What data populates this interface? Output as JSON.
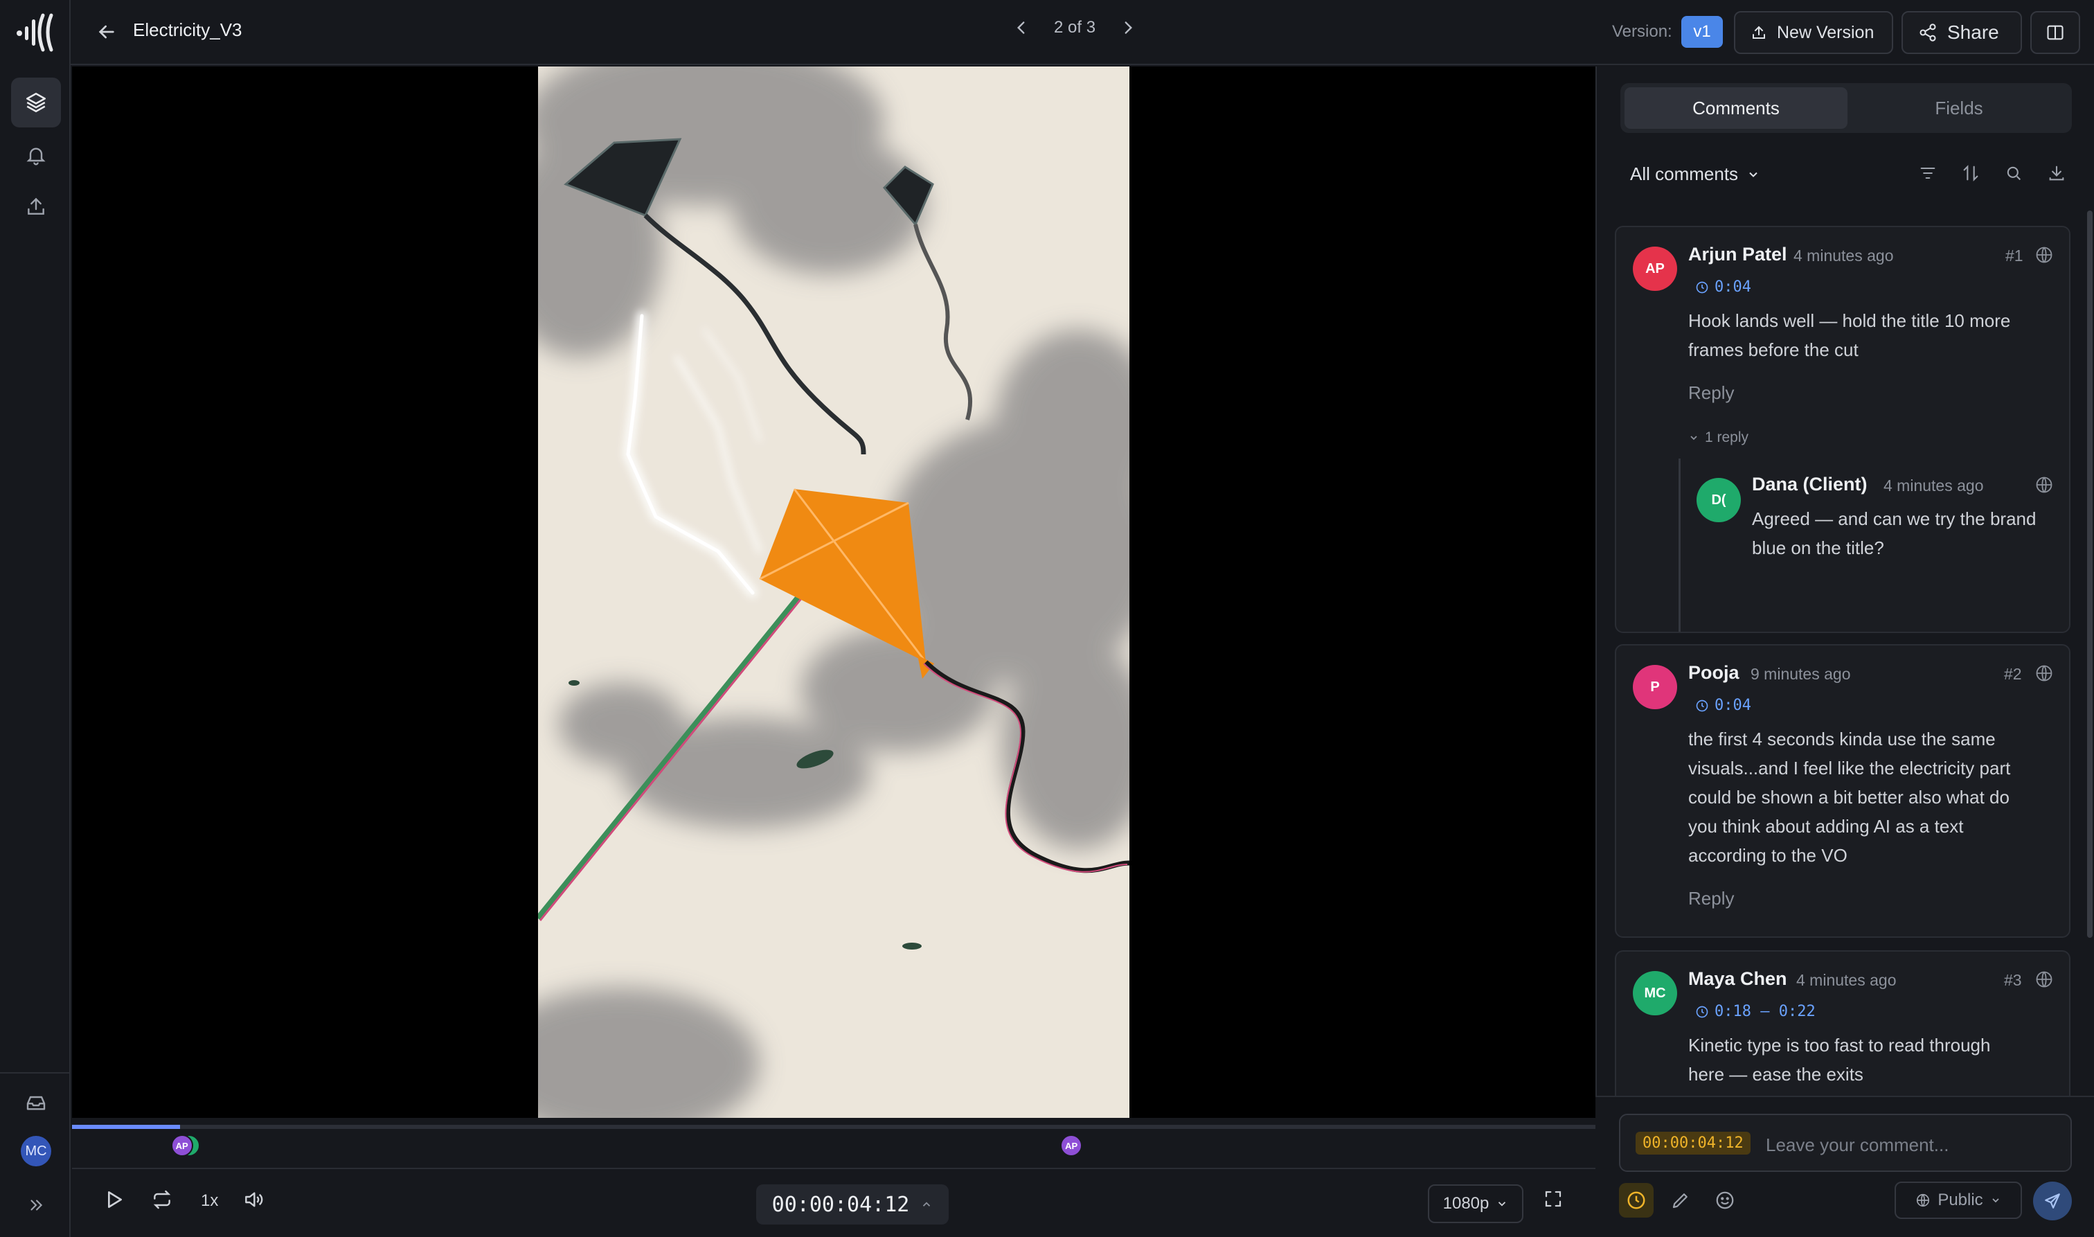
{
  "app": {
    "logo_icon": "waveform-logo-icon"
  },
  "rail": {
    "items": [
      {
        "name": "layers-icon",
        "active": true
      },
      {
        "name": "bell-icon",
        "active": false
      },
      {
        "name": "upload-icon",
        "active": false
      }
    ],
    "bottom": {
      "inbox_icon": "inbox-icon",
      "user_initials": "MC",
      "expand_icon": "double-chevron-right-icon"
    }
  },
  "header": {
    "file_title": "Electricity_V3",
    "pager": "2 of 3",
    "version_label": "Version:",
    "version_value": "v1",
    "new_version_label": "New Version",
    "share_label": "Share"
  },
  "player": {
    "progress": 0.071,
    "timecode": "00:00:04:12",
    "speed": "1x",
    "quality": "1080p",
    "markers": [
      {
        "initials": "AP",
        "at": 0.073
      },
      {
        "initials": "AP",
        "at": 0.656
      }
    ]
  },
  "panel": {
    "tabs": [
      "Comments",
      "Fields"
    ],
    "active_tab": "Comments",
    "filter_label": "All comments",
    "comments": [
      {
        "initials": "AP",
        "author": "Arjun Patel",
        "time": "4 minutes ago",
        "number": "#1",
        "timestamp": "0:04",
        "color": "#e5334b",
        "text_lines": [
          "Hook lands well — hold the title 10 more",
          "frames before the cut"
        ],
        "reply_label": "Reply",
        "replies_toggle": "1 reply",
        "replies": [
          {
            "initials": "D(",
            "author": "Dana (Client)",
            "time": "4 minutes ago",
            "color": "#1faa6b",
            "text_lines": [
              "Agreed — and can we try the brand",
              "blue on the title?"
            ]
          }
        ]
      },
      {
        "initials": "P",
        "author": "Pooja",
        "time": "9 minutes ago",
        "number": "#2",
        "timestamp": "0:04",
        "color": "#e0357a",
        "text_lines": [
          "the first 4 seconds kinda use the same",
          "visuals...and I feel like the electricity part",
          "could be shown a bit better also what do",
          "you think about adding AI as a text",
          "according to the VO"
        ],
        "reply_label": "Reply"
      },
      {
        "initials": "MC",
        "author": "Maya Chen",
        "time": "4 minutes ago",
        "number": "#3",
        "timestamp": "0:18 – 0:22",
        "color": "#1faa6b",
        "text_lines": [
          "Kinetic type is too fast to read through",
          "here — ease the exits"
        ]
      }
    ]
  },
  "composer": {
    "timecode_chip": "00:00:04:12",
    "placeholder": "Leave your comment...",
    "visibility": "Public"
  }
}
